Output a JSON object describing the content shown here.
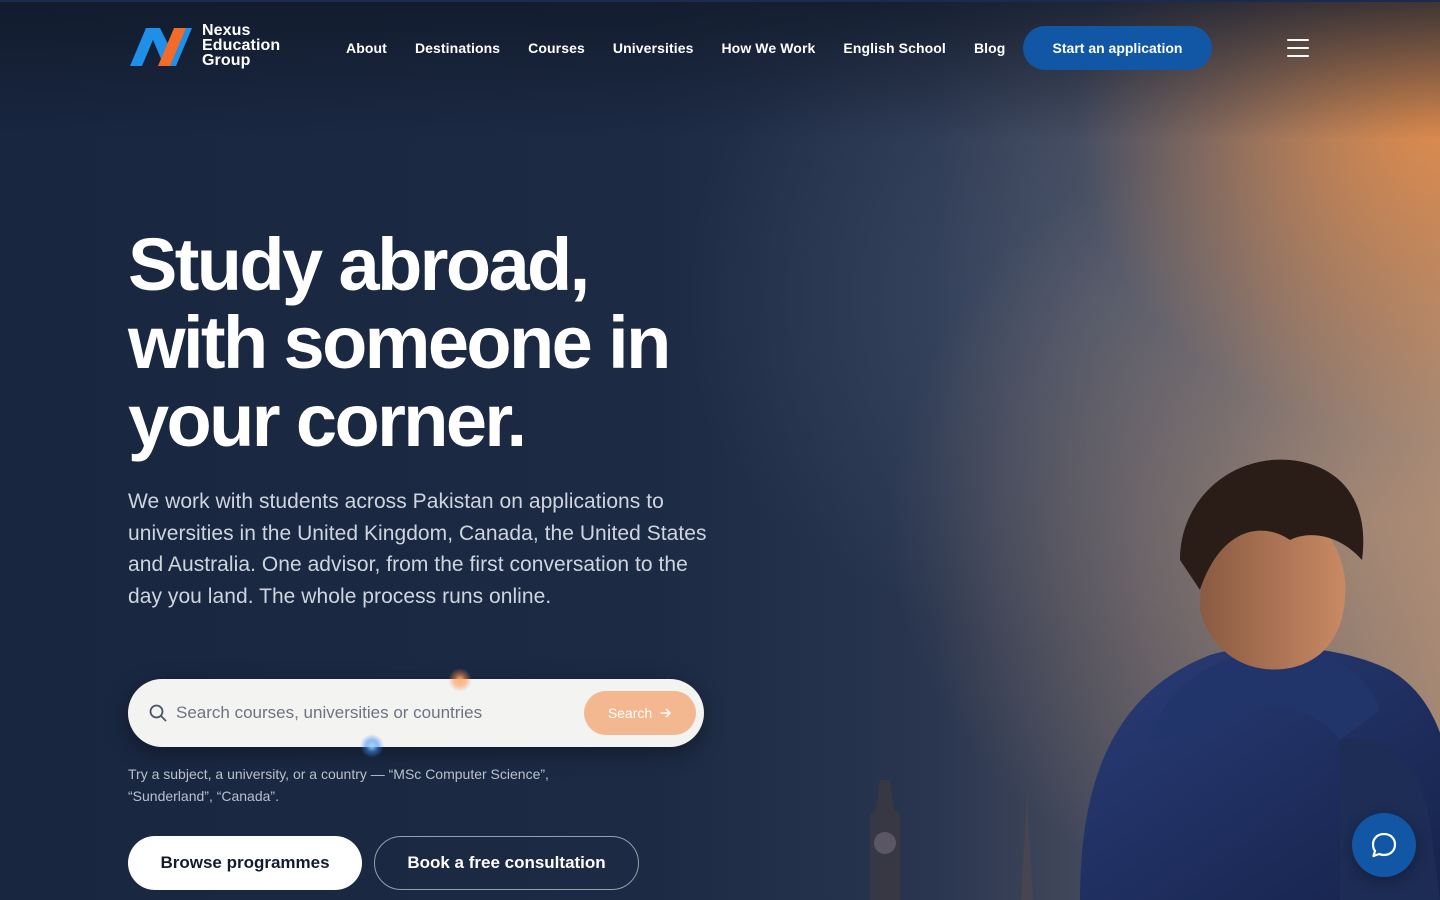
{
  "brand": {
    "name_line1": "Nexus",
    "name_line2": "Education",
    "name_line3": "Group",
    "colors": {
      "blue": "#1f8fe8",
      "orange": "#f26b2a",
      "cta": "#1256a6"
    }
  },
  "nav": {
    "items": [
      {
        "label": "About"
      },
      {
        "label": "Destinations"
      },
      {
        "label": "Courses"
      },
      {
        "label": "Universities"
      },
      {
        "label": "How We Work"
      },
      {
        "label": "English School"
      },
      {
        "label": "Blog"
      }
    ],
    "cta_label": "Start an application",
    "menu_icon": "hamburger-menu-icon"
  },
  "hero": {
    "headline_line1": "Study abroad,",
    "headline_line2": "with someone in",
    "headline_line3": "your corner.",
    "subtext": "We work with students across Pakistan on applications to universities in the United Kingdom, Canada, the United States and Australia. One advisor, from the first conversation to the day you land. The whole process runs online."
  },
  "search": {
    "placeholder": "Search courses, universities or countries",
    "button_label": "Search",
    "hint": "Try a subject, a university, or a country — “MSc Computer Science”, “Sunderland”, “Canada”."
  },
  "actions": {
    "browse_label": "Browse programmes",
    "consult_label": "Book a free consultation"
  },
  "chat": {
    "icon": "chat-bubble-icon"
  }
}
